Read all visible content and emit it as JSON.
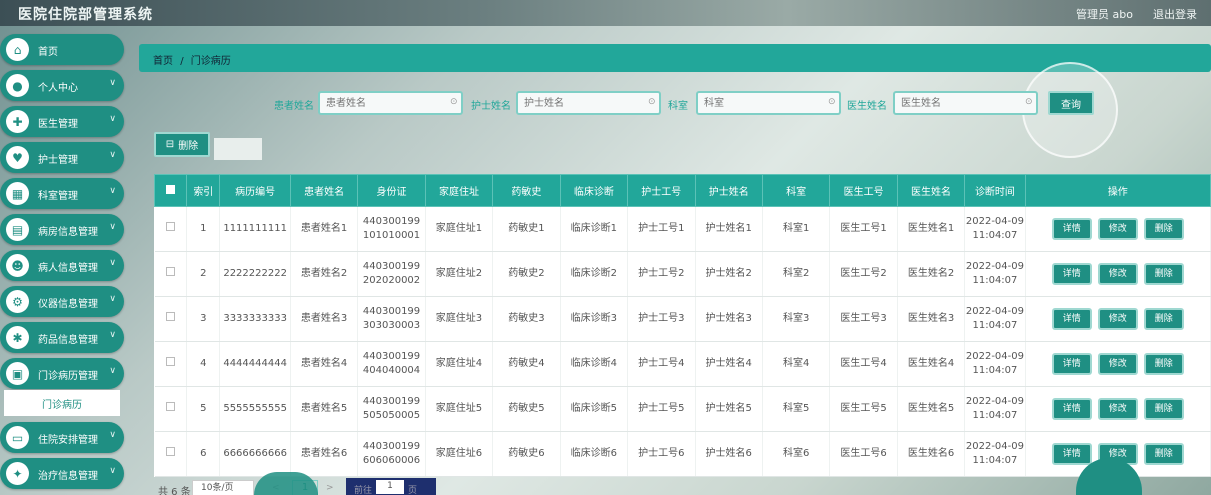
{
  "header": {
    "title": "医院住院部管理系统",
    "admin": "管理员 abo",
    "logout": "退出登录"
  },
  "sidebar": {
    "items": [
      {
        "label": "首页",
        "icon": "home-icon",
        "chevron": false
      },
      {
        "label": "个人中心",
        "icon": "user-icon",
        "chevron": true
      },
      {
        "label": "医生管理",
        "icon": "doctor-icon",
        "chevron": true
      },
      {
        "label": "护士管理",
        "icon": "nurse-icon",
        "chevron": true
      },
      {
        "label": "科室管理",
        "icon": "department-icon",
        "chevron": true
      },
      {
        "label": "病房信息管理",
        "icon": "ward-icon",
        "chevron": true
      },
      {
        "label": "病人信息管理",
        "icon": "patient-icon",
        "chevron": true
      },
      {
        "label": "仪器信息管理",
        "icon": "instrument-icon",
        "chevron": true
      },
      {
        "label": "药品信息管理",
        "icon": "medicine-icon",
        "chevron": true
      },
      {
        "label": "门诊病历管理",
        "icon": "record-icon",
        "chevron": true
      },
      {
        "label": "住院安排管理",
        "icon": "bed-icon",
        "chevron": true
      },
      {
        "label": "治疗信息管理",
        "icon": "treatment-icon",
        "chevron": true
      }
    ],
    "sub_item": "门诊病历"
  },
  "breadcrumb": {
    "home": "首页",
    "sep": "/",
    "current": "门诊病历"
  },
  "search": {
    "patient_label": "患者姓名",
    "patient_placeholder": "患者姓名",
    "nurse_label": "护士姓名",
    "nurse_placeholder": "护士姓名",
    "dept_label": "科室",
    "dept_placeholder": "科室",
    "doctor_label": "医生姓名",
    "doctor_placeholder": "医生姓名",
    "query_label": "查询"
  },
  "toolbar": {
    "delete_label": "删除"
  },
  "table": {
    "headers": [
      "索引",
      "病历编号",
      "患者姓名",
      "身份证",
      "家庭住址",
      "药敏史",
      "临床诊断",
      "护士工号",
      "护士姓名",
      "科室",
      "医生工号",
      "医生姓名",
      "诊断时间",
      "操作"
    ],
    "rows": [
      [
        "1",
        "1111111111",
        "患者姓名1",
        "440300199 101010001",
        "家庭住址1",
        "药敏史1",
        "临床诊断1",
        "护士工号1",
        "护士姓名1",
        "科室1",
        "医生工号1",
        "医生姓名1",
        "2022-04-09 11:04:07"
      ],
      [
        "2",
        "2222222222",
        "患者姓名2",
        "440300199 202020002",
        "家庭住址2",
        "药敏史2",
        "临床诊断2",
        "护士工号2",
        "护士姓名2",
        "科室2",
        "医生工号2",
        "医生姓名2",
        "2022-04-09 11:04:07"
      ],
      [
        "3",
        "3333333333",
        "患者姓名3",
        "440300199 303030003",
        "家庭住址3",
        "药敏史3",
        "临床诊断3",
        "护士工号3",
        "护士姓名3",
        "科室3",
        "医生工号3",
        "医生姓名3",
        "2022-04-09 11:04:07"
      ],
      [
        "4",
        "4444444444",
        "患者姓名4",
        "440300199 404040004",
        "家庭住址4",
        "药敏史4",
        "临床诊断4",
        "护士工号4",
        "护士姓名4",
        "科室4",
        "医生工号4",
        "医生姓名4",
        "2022-04-09 11:04:07"
      ],
      [
        "5",
        "5555555555",
        "患者姓名5",
        "440300199 505050005",
        "家庭住址5",
        "药敏史5",
        "临床诊断5",
        "护士工号5",
        "护士姓名5",
        "科室5",
        "医生工号5",
        "医生姓名5",
        "2022-04-09 11:04:07"
      ],
      [
        "6",
        "6666666666",
        "患者姓名6",
        "440300199 606060006",
        "家庭住址6",
        "药敏史6",
        "临床诊断6",
        "护士工号6",
        "护士姓名6",
        "科室6",
        "医生工号6",
        "医生姓名6",
        "2022-04-09 11:04:07"
      ]
    ],
    "actions": [
      "详情",
      "修改",
      "删除"
    ]
  },
  "pagination": {
    "total": "共 6 条",
    "page_size": "10条/页",
    "prev": "<",
    "current": "1",
    "next": ">",
    "goto_label": "前往",
    "goto_value": "1",
    "goto_unit": "页"
  },
  "colors": {
    "accent": "#22a79a",
    "button": "#1f8f83"
  }
}
